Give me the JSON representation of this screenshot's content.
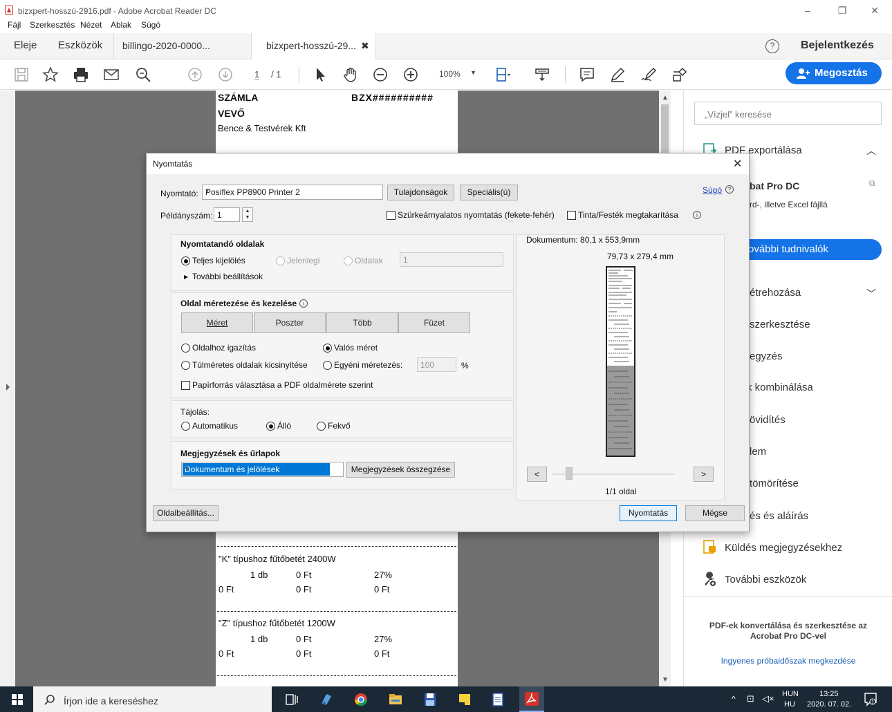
{
  "window": {
    "title": "bizxpert-hosszú-2916.pdf - Adobe Acrobat Reader DC",
    "menu": [
      "Fájl",
      "Szerkesztés",
      "Nézet",
      "Ablak",
      "Súgó"
    ]
  },
  "tabs": {
    "home": "Eleje",
    "tools": "Eszközök",
    "doc1": "billingo-2020-0000...",
    "doc2": "bizxpert-hosszú-29...",
    "signin": "Bejelentkezés"
  },
  "toolbar": {
    "page_current": "1",
    "page_total": "/ 1",
    "zoom": "100%",
    "share": "Megosztás"
  },
  "document": {
    "heading": "SZÁMLA",
    "invoice_no": "BZX##########",
    "buyer_label": "VEVŐ",
    "buyer_name": "Bence & Testvérek Kft",
    "items": [
      {
        "name": "\"K\" típushoz fűtőbetét 2400W",
        "qty": "1 db",
        "price": "0 Ft",
        "vat": "27%",
        "net": "0 Ft",
        "vat_amt": "0 Ft",
        "gross": "0 Ft"
      },
      {
        "name": "\"Z\" típushoz fűtőbetét 1200W",
        "qty": "1 db",
        "price": "0 Ft",
        "vat": "27%",
        "net": "0 Ft",
        "vat_amt": "0 Ft",
        "gross": "0 Ft"
      }
    ]
  },
  "right_panel": {
    "search_placeholder": "„Vízjel” keresése",
    "export_pdf": "PDF exportálása",
    "pro_title": "bat Pro DC",
    "pro_desc": "rd-, illetve Excel fájllá",
    "learn_more": "ovábbi tudnivalók",
    "items": [
      "étrehozása",
      "szerkesztése",
      "egyzés",
      "k kombinálása",
      "övidítés",
      "lem",
      "tömörítése",
      "és és aláírás"
    ],
    "send_comments": "Küldés megjegyzésekhez",
    "more_tools": "További eszközök",
    "promo": "PDF-ek konvertálása és szerkesztése az Acrobat Pro DC-vel",
    "trial": "Ingyenes próbaidőszak megkezdése"
  },
  "dialog": {
    "title": "Nyomtatás",
    "printer_label": "Nyomtató:",
    "printer_value": "Posiflex PP8900 Printer 2",
    "properties": "Tulajdonságok",
    "advanced": "Speciális(ú)",
    "help": "Súgó",
    "copies_label": "Példányszám:",
    "copies_value": "1",
    "grayscale": "Szürkeárnyalatos nyomtatás (fekete-fehér)",
    "ink_save": "Tinta/Festék megtakarítása",
    "pages_group": "Nyomtatandó oldalak",
    "all_pages": "Teljes kijelölés",
    "current_page": "Jelenlegi",
    "pages": "Oldalak",
    "pages_value": "1",
    "more_options": "További beállítások",
    "sizing_group": "Oldal méretezése és kezelése",
    "size_tabs": [
      "Méret",
      "Poszter",
      "Több",
      "Füzet"
    ],
    "fit": "Oldalhoz igazítás",
    "actual_size": "Valós méret",
    "shrink": "Túlméretes oldalak kicsinyítése",
    "custom_scale": "Egyéni méretezés:",
    "custom_scale_value": "100",
    "percent": "%",
    "paper_source": "Papírforrás választása a PDF oldalmérete szerint",
    "orientation_label": "Tájolás:",
    "auto": "Automatikus",
    "portrait": "Álló",
    "landscape": "Fekvő",
    "comments_group": "Megjegyzések és űrlapok",
    "comments_value": "Dokumentum és jelölések",
    "summarize": "Megjegyzések összegzése",
    "doc_size": "Dokumentum: 80,1 x 553,9mm",
    "paper_size": "79,73 x 279,4 mm",
    "prev": "<",
    "next": ">",
    "page_count": "1/1 oldal",
    "page_setup": "Oldalbeállítás...",
    "print": "Nyomtatás",
    "cancel": "Mégse"
  },
  "taskbar": {
    "search": "Írjon ide a kereséshez",
    "lang1": "HUN",
    "lang2": "HU",
    "time": "13:25",
    "date": "2020. 07. 02."
  }
}
